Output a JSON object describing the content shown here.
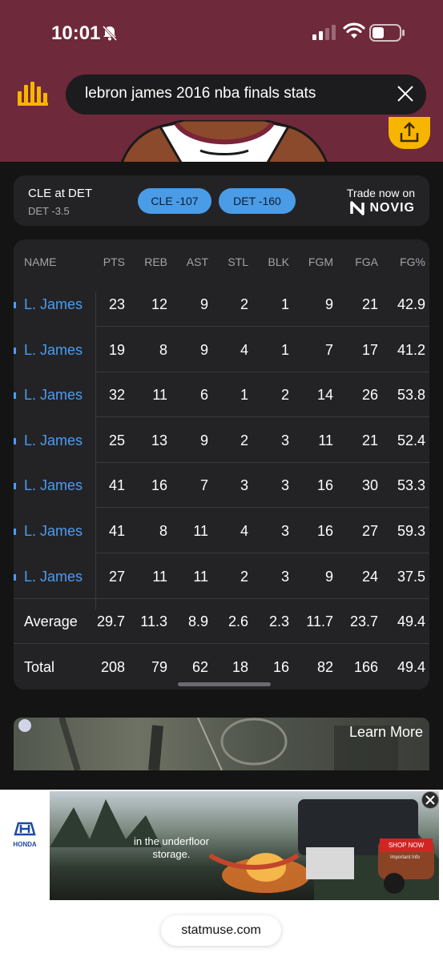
{
  "status_bar": {
    "time": "10:01"
  },
  "search": {
    "query": "lebron james 2016 nba finals stats"
  },
  "odds": {
    "matchup": "CLE at DET",
    "spread": "DET -3.5",
    "buttons": [
      {
        "label": "CLE -107"
      },
      {
        "label": "DET -160"
      }
    ],
    "trade_label": "Trade now on",
    "brand": "NOVIG"
  },
  "table": {
    "headers": {
      "name": "NAME",
      "pts": "PTS",
      "reb": "REB",
      "ast": "AST",
      "stl": "STL",
      "blk": "BLK",
      "fgm": "FGM",
      "fga": "FGA",
      "fgp": "FG%"
    },
    "rows": [
      {
        "name": "L. James",
        "pts": "23",
        "reb": "12",
        "ast": "9",
        "stl": "2",
        "blk": "1",
        "fgm": "9",
        "fga": "21",
        "fgp": "42.9"
      },
      {
        "name": "L. James",
        "pts": "19",
        "reb": "8",
        "ast": "9",
        "stl": "4",
        "blk": "1",
        "fgm": "7",
        "fga": "17",
        "fgp": "41.2"
      },
      {
        "name": "L. James",
        "pts": "32",
        "reb": "11",
        "ast": "6",
        "stl": "1",
        "blk": "2",
        "fgm": "14",
        "fga": "26",
        "fgp": "53.8"
      },
      {
        "name": "L. James",
        "pts": "25",
        "reb": "13",
        "ast": "9",
        "stl": "2",
        "blk": "3",
        "fgm": "11",
        "fga": "21",
        "fgp": "52.4"
      },
      {
        "name": "L. James",
        "pts": "41",
        "reb": "16",
        "ast": "7",
        "stl": "3",
        "blk": "3",
        "fgm": "16",
        "fga": "30",
        "fgp": "53.3"
      },
      {
        "name": "L. James",
        "pts": "41",
        "reb": "8",
        "ast": "11",
        "stl": "4",
        "blk": "3",
        "fgm": "16",
        "fga": "27",
        "fgp": "59.3"
      },
      {
        "name": "L. James",
        "pts": "27",
        "reb": "11",
        "ast": "11",
        "stl": "2",
        "blk": "3",
        "fgm": "9",
        "fga": "24",
        "fgp": "37.5"
      }
    ],
    "average": {
      "name": "Average",
      "pts": "29.7",
      "reb": "11.3",
      "ast": "8.9",
      "stl": "2.6",
      "blk": "2.3",
      "fgm": "11.7",
      "fga": "23.7",
      "fgp": "49.4"
    },
    "total": {
      "name": "Total",
      "pts": "208",
      "reb": "79",
      "ast": "62",
      "stl": "18",
      "blk": "16",
      "fgm": "82",
      "fga": "166",
      "fgp": "49.4"
    }
  },
  "banner_ad": {
    "cta": "Learn More"
  },
  "honda_ad": {
    "brand": "HONDA",
    "caption": "in the underfloor storage.",
    "button": "SHOP NOW",
    "fine_print": "Important Info"
  },
  "browser": {
    "url": "statmuse.com"
  },
  "colors": {
    "header_bg": "#6e2a3a",
    "accent_yellow": "#f7b500",
    "link_blue": "#4c9cf0",
    "odds_blue": "#4a9ce6"
  }
}
